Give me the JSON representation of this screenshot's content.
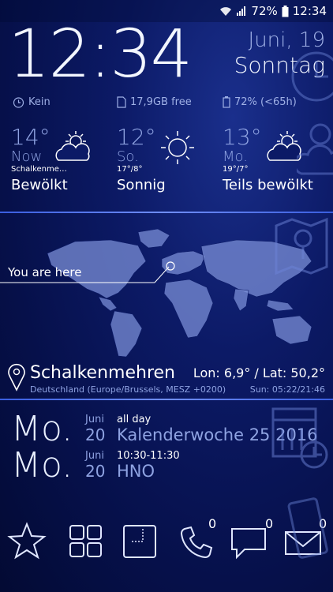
{
  "status": {
    "battery_pct": "72%",
    "time": "12:34"
  },
  "clock": {
    "time": "12:34",
    "date": "Juni, 19",
    "weekday": "Sonntag"
  },
  "info": {
    "alarm": "Kein",
    "storage": "17,9GB free",
    "battery": "72% (<65h)"
  },
  "weather": [
    {
      "temp": "14°",
      "day": "Now",
      "place": "Schalkenme…",
      "cond": "Bewölkt",
      "icon": "partly-cloudy-icon"
    },
    {
      "temp": "12°",
      "day": "So.",
      "range": "17°/8°",
      "cond": "Sonnig",
      "icon": "sun-icon"
    },
    {
      "temp": "13°",
      "day": "Mo.",
      "range": "19°/7°",
      "cond": "Teils bewölkt",
      "icon": "partly-cloudy-icon"
    }
  ],
  "map": {
    "you_are_here": "You are here"
  },
  "location": {
    "name": "Schalkenmehren",
    "sub": "Deutschland (Europe/Brussels, MESZ +0200)",
    "lonlat": "Lon: 6,9° / Lat: 50,2°",
    "sun": "Sun: 05:22/21:46"
  },
  "calendar": [
    {
      "day": "Mo.",
      "month": "Juni",
      "date": "20",
      "time": "all day",
      "title": "Kalenderwoche 25 2016"
    },
    {
      "day": "Mo.",
      "month": "Juni",
      "date": "20",
      "time": "10:30-11:30",
      "title": "HNO"
    }
  ],
  "dock": {
    "phone_badge": "0",
    "sms_badge": "0",
    "mail_badge": "0"
  },
  "colors": {
    "accent": "#4a6ef0",
    "bg": "#0c1a66",
    "muted": "#8fa3e2"
  }
}
